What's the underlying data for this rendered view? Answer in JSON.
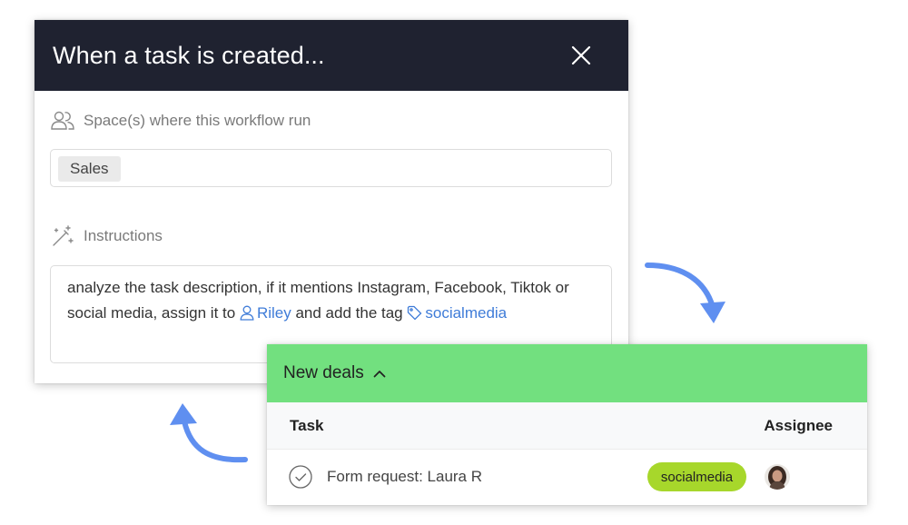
{
  "modal": {
    "title": "When a task is created...",
    "spaces_label": "Space(s) where this workflow run",
    "space_chip": "Sales",
    "instructions_label": "Instructions",
    "instructions": {
      "line1": "analyze the task description, if it mentions Instagram, Facebook, Tiktok or",
      "line2_prefix": "social media, assign it to",
      "assignee_mention": "Riley",
      "line2_middle": "and add the tag",
      "tag_mention": "socialmedia"
    },
    "icons": {
      "close": "close-icon",
      "users": "users-icon",
      "magic": "magic-wand-icon",
      "user": "user-icon",
      "tag": "tag-icon"
    }
  },
  "deals": {
    "group_title": "New deals",
    "columns": {
      "task": "Task",
      "assignee": "Assignee"
    },
    "rows": [
      {
        "task": "Form request: Laura R",
        "tag": "socialmedia",
        "assignee_avatar": "avatar"
      }
    ]
  },
  "colors": {
    "header_dark": "#1f2230",
    "accent_blue": "#3f7cd8",
    "group_green": "#72e07f",
    "tag_green": "#a7d72b",
    "arrow_blue": "#5f8ff0"
  }
}
